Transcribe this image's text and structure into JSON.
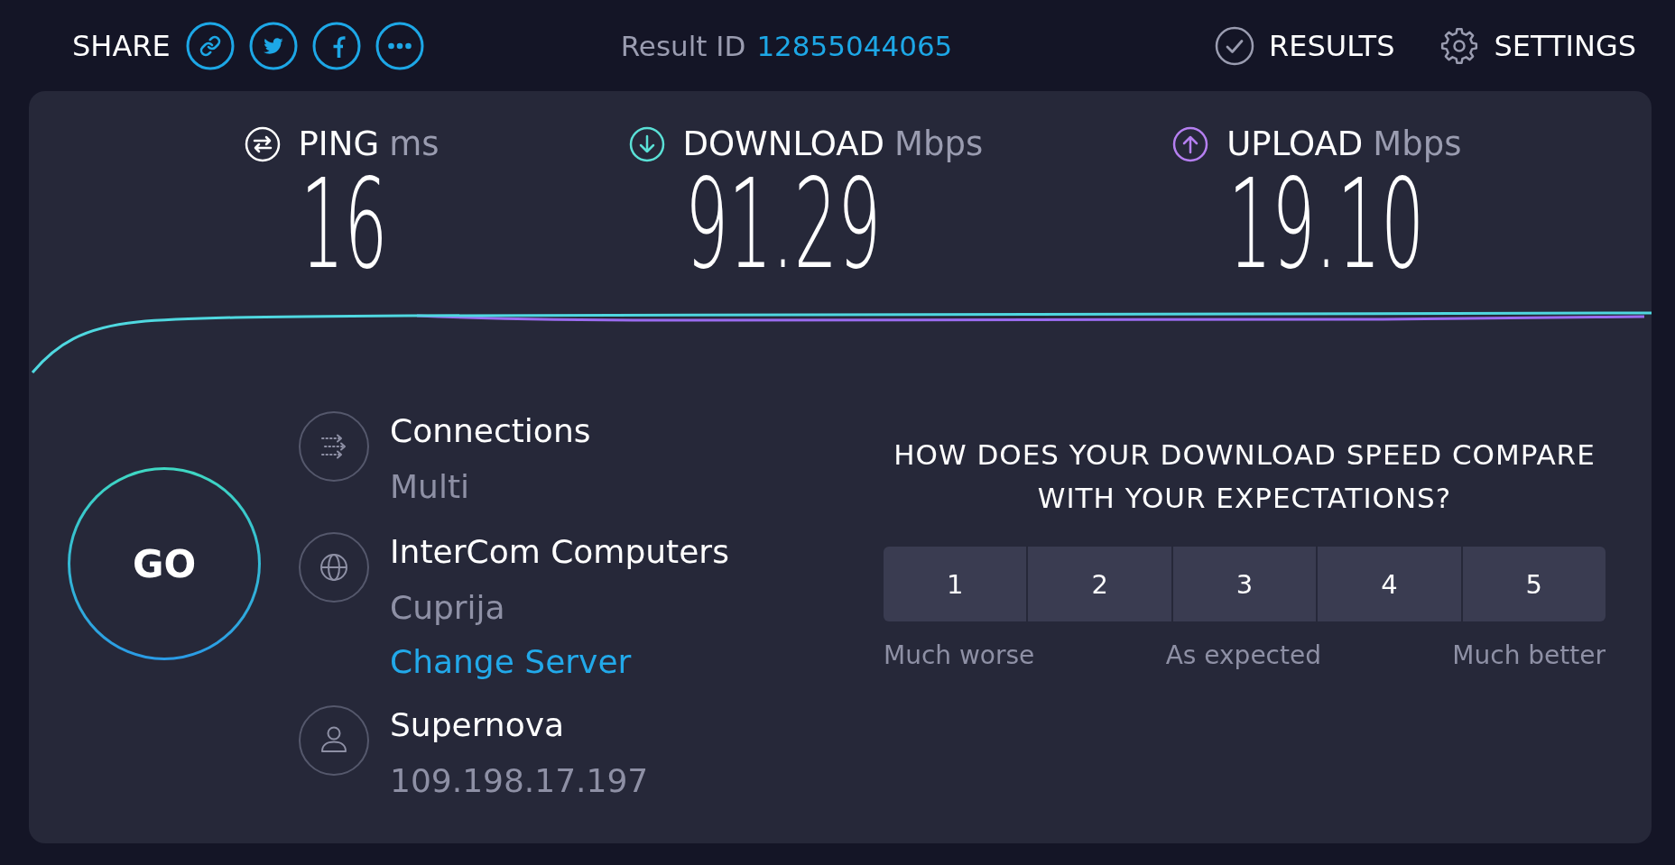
{
  "share": {
    "label": "SHARE"
  },
  "result_id": {
    "label": "Result ID",
    "value": "12855044065"
  },
  "nav": [
    {
      "kind": "results",
      "label": "RESULTS"
    },
    {
      "kind": "settings",
      "label": "SETTINGS"
    }
  ],
  "metrics": [
    {
      "kind": "ping",
      "label": "PING",
      "unit": "ms",
      "value": "16",
      "color": "#ffffff"
    },
    {
      "kind": "download",
      "label": "DOWNLOAD",
      "unit": "Mbps",
      "value": "91.29",
      "color": "#5ae0d6"
    },
    {
      "kind": "upload",
      "label": "UPLOAD",
      "unit": "Mbps",
      "value": "19.10",
      "color": "#b57ff0"
    }
  ],
  "go_button": {
    "label": "GO"
  },
  "server_info": [
    {
      "kind": "connections",
      "title": "Connections",
      "subtitle": "Multi"
    },
    {
      "kind": "server",
      "title": "InterCom Computers",
      "subtitle": "Cuprija",
      "link": "Change Server"
    },
    {
      "kind": "provider",
      "title": "Supernova",
      "subtitle": "109.198.17.197"
    }
  ],
  "survey": {
    "question": "HOW DOES YOUR DOWNLOAD SPEED COMPARE WITH YOUR EXPECTATIONS?",
    "options": [
      {
        "label": "1",
        "selected": false
      },
      {
        "label": "2",
        "selected": false
      },
      {
        "label": "3",
        "selected": false
      },
      {
        "label": "4",
        "selected": false
      },
      {
        "label": "5",
        "selected": false
      }
    ],
    "scale_labels": [
      "Much worse",
      "As expected",
      "Much better"
    ]
  }
}
